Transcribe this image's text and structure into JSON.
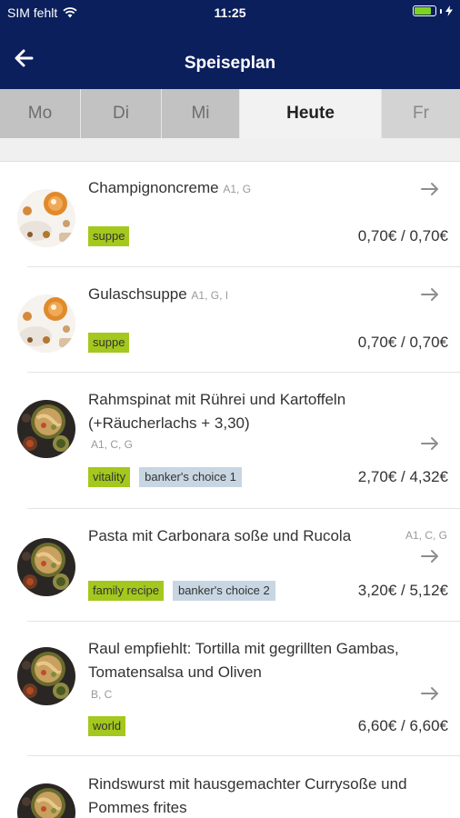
{
  "status": {
    "carrier": "SIM fehlt",
    "time": "11:25",
    "battery_level": 0.85,
    "accent": "#0b1f5c"
  },
  "nav": {
    "title": "Speiseplan",
    "back_icon": "arrow-left-icon"
  },
  "tabs": [
    {
      "label": "Mo",
      "active": false
    },
    {
      "label": "Di",
      "active": false
    },
    {
      "label": "Mi",
      "active": false
    },
    {
      "label": "Heute",
      "active": true
    },
    {
      "label": "Fr",
      "active": false
    }
  ],
  "menu": [
    {
      "name": "Champignoncreme",
      "allergens": "A1, G",
      "tags": [
        {
          "label": "suppe",
          "kind": "green"
        }
      ],
      "price": "0,70€ / 0,70€",
      "image": "soup"
    },
    {
      "name": "Gulaschsuppe",
      "allergens": "A1, G, I",
      "tags": [
        {
          "label": "suppe",
          "kind": "green"
        }
      ],
      "price": "0,70€ / 0,70€",
      "image": "soup"
    },
    {
      "name_lines": [
        "Rahmspinat mit Rührei und Kartoffeln",
        "(+Räucherlachs + 3,30)"
      ],
      "allergens": "A1, C, G",
      "tags": [
        {
          "label": "vitality",
          "kind": "green"
        },
        {
          "label": "banker's choice 1",
          "kind": "blue"
        }
      ],
      "price": "2,70€ / 4,32€",
      "image": "dish"
    },
    {
      "name": "Pasta mit Carbonara soße und Rucola",
      "allergens": "A1, C, G",
      "tags": [
        {
          "label": "family recipe",
          "kind": "green"
        },
        {
          "label": "banker's choice 2",
          "kind": "blue"
        }
      ],
      "price": "3,20€ / 5,12€",
      "image": "dish"
    },
    {
      "name_lines": [
        "Raul empfiehlt: Tortilla mit gegrillten Gambas,",
        "Tomatensalsa und Oliven"
      ],
      "allergens": "B, C",
      "tags": [
        {
          "label": "world",
          "kind": "green"
        }
      ],
      "price": "6,60€ / 6,60€",
      "image": "dish"
    },
    {
      "name_lines": [
        "Rindswurst mit hausgemachter Currysoße und",
        "Pommes frites"
      ],
      "image": "dish"
    }
  ]
}
